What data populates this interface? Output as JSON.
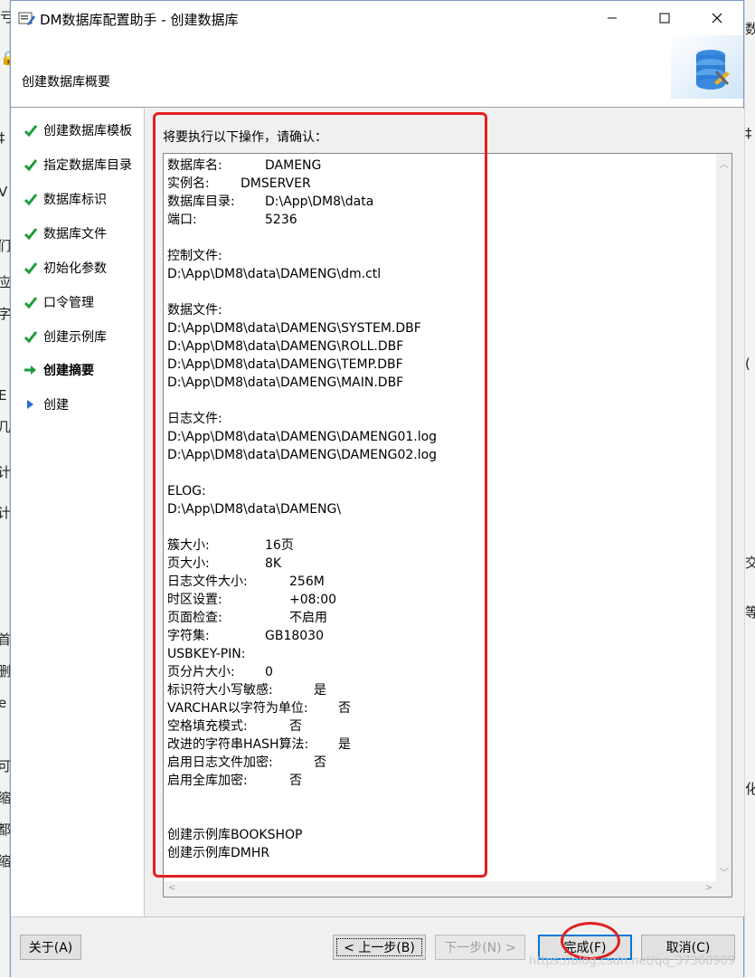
{
  "window": {
    "title": "DM数据库配置助手 - 创建数据库",
    "header_title": "创建数据库概要"
  },
  "nav": {
    "items": [
      {
        "label": "创建数据库模板",
        "state": "done"
      },
      {
        "label": "指定数据库目录",
        "state": "done"
      },
      {
        "label": "数据库标识",
        "state": "done"
      },
      {
        "label": "数据库文件",
        "state": "done"
      },
      {
        "label": "初始化参数",
        "state": "done"
      },
      {
        "label": "口令管理",
        "state": "done"
      },
      {
        "label": "创建示例库",
        "state": "done"
      },
      {
        "label": "创建摘要",
        "state": "current"
      },
      {
        "label": "创建",
        "state": "pending"
      }
    ]
  },
  "content": {
    "confirm_label": "将要执行以下操作，请确认："
  },
  "summary": {
    "db_name_k": "数据库名:",
    "db_name_v": "DAMENG",
    "instance_k": "实例名:",
    "instance_v": "DMSERVER",
    "db_dir_k": "数据库目录:",
    "db_dir_v": "D:\\App\\DM8\\data",
    "port_k": "端口:",
    "port_v": "5236",
    "ctl_header": "控制文件:",
    "ctl_file": "D:\\App\\DM8\\data\\DAMENG\\dm.ctl",
    "data_header": "数据文件:",
    "data_files": [
      "D:\\App\\DM8\\data\\DAMENG\\SYSTEM.DBF",
      "D:\\App\\DM8\\data\\DAMENG\\ROLL.DBF",
      "D:\\App\\DM8\\data\\DAMENG\\TEMP.DBF",
      "D:\\App\\DM8\\data\\DAMENG\\MAIN.DBF"
    ],
    "log_header": "日志文件:",
    "log_files": [
      "D:\\App\\DM8\\data\\DAMENG\\DAMENG01.log",
      "D:\\App\\DM8\\data\\DAMENG\\DAMENG02.log"
    ],
    "elog_header": "ELOG:",
    "elog_path": "D:\\App\\DM8\\data\\DAMENG\\",
    "params": [
      {
        "k": "簇大小:",
        "v": "16页"
      },
      {
        "k": "页大小:",
        "v": "8K"
      },
      {
        "k": "日志文件大小:",
        "v": "256M"
      },
      {
        "k": "时区设置:",
        "v": "+08:00"
      },
      {
        "k": "页面检查:",
        "v": "不启用"
      },
      {
        "k": "字符集:",
        "v": "GB18030"
      },
      {
        "k": "USBKEY-PIN:",
        "v": ""
      },
      {
        "k": "页分片大小:",
        "v": "0"
      },
      {
        "k": "标识符大小写敏感:",
        "v": "是"
      },
      {
        "k": "VARCHAR以字符为单位:",
        "v": "否"
      },
      {
        "k": "空格填充模式:",
        "v": "否"
      },
      {
        "k": "改进的字符串HASH算法:",
        "v": "是"
      },
      {
        "k": "启用日志文件加密:",
        "v": "否"
      },
      {
        "k": "启用全库加密:",
        "v": "否"
      }
    ],
    "samples": [
      "创建示例库BOOKSHOP",
      "创建示例库DMHR"
    ]
  },
  "buttons": {
    "about": "关于(A)",
    "back": "< 上一步(B)",
    "next": "下一步(N) >",
    "finish": "完成(F)",
    "cancel": "取消(C)"
  },
  "watermark": "https://blog.csdn.net/qq_37368909",
  "colors": {
    "check": "#1a9c3a",
    "current_arrow": "#1a9c3a",
    "pending_arrow": "#1f6fd0",
    "annotation": "#e02020"
  }
}
